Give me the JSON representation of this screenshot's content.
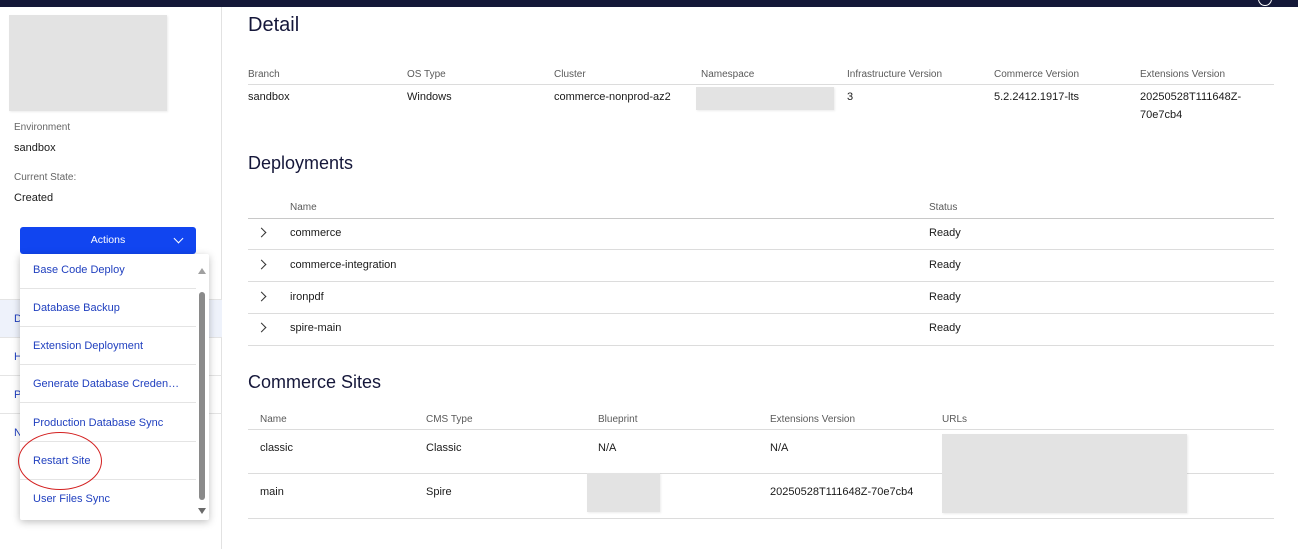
{
  "sidebar": {
    "environment_label": "Environment",
    "environment_value": "sandbox",
    "state_label": "Current State:",
    "state_value": "Created",
    "nav_items": [
      {
        "label": "D"
      },
      {
        "label": "H"
      },
      {
        "label": "P"
      },
      {
        "label": "N"
      }
    ],
    "actions_label": "Actions",
    "actions_menu": [
      {
        "label": "Base Code Deploy"
      },
      {
        "label": "Database Backup"
      },
      {
        "label": "Extension Deployment"
      },
      {
        "label": "Generate Database Creden…"
      },
      {
        "label": "Production Database Sync"
      },
      {
        "label": "Restart Site"
      },
      {
        "label": "User Files Sync"
      }
    ]
  },
  "detail": {
    "title": "Detail",
    "headers": [
      "Branch",
      "OS Type",
      "Cluster",
      "Namespace",
      "Infrastructure Version",
      "Commerce Version",
      "Extensions Version"
    ],
    "row": {
      "branch": "sandbox",
      "os_type": "Windows",
      "cluster": "commerce-nonprod-az2",
      "infrastructure_version": "3",
      "commerce_version": "5.2.2412.1917-lts",
      "extensions_version_line1": "20250528T111648Z-",
      "extensions_version_line2": "70e7cb4"
    }
  },
  "deployments": {
    "title": "Deployments",
    "headers": [
      "Name",
      "Status"
    ],
    "rows": [
      {
        "name": "commerce",
        "status": "Ready"
      },
      {
        "name": "commerce-integration",
        "status": "Ready"
      },
      {
        "name": "ironpdf",
        "status": "Ready"
      },
      {
        "name": "spire-main",
        "status": "Ready"
      }
    ]
  },
  "commerce_sites": {
    "title": "Commerce Sites",
    "headers": [
      "Name",
      "CMS Type",
      "Blueprint",
      "Extensions Version",
      "URLs"
    ],
    "rows": [
      {
        "name": "classic",
        "cms_type": "Classic",
        "blueprint": "N/A",
        "extensions_version": "N/A"
      },
      {
        "name": "main",
        "cms_type": "Spire",
        "blueprint": "",
        "extensions_version": "20250528T111648Z-70e7cb4"
      }
    ]
  },
  "colors": {
    "topbar": "#141838",
    "primary_button": "#1145f0",
    "link": "#1f3fbf",
    "highlight_ring": "#d32020"
  },
  "icons": [
    "chevron-down-icon",
    "chevron-right-icon",
    "scroll-up-arrow-icon",
    "scroll-down-arrow-icon"
  ]
}
